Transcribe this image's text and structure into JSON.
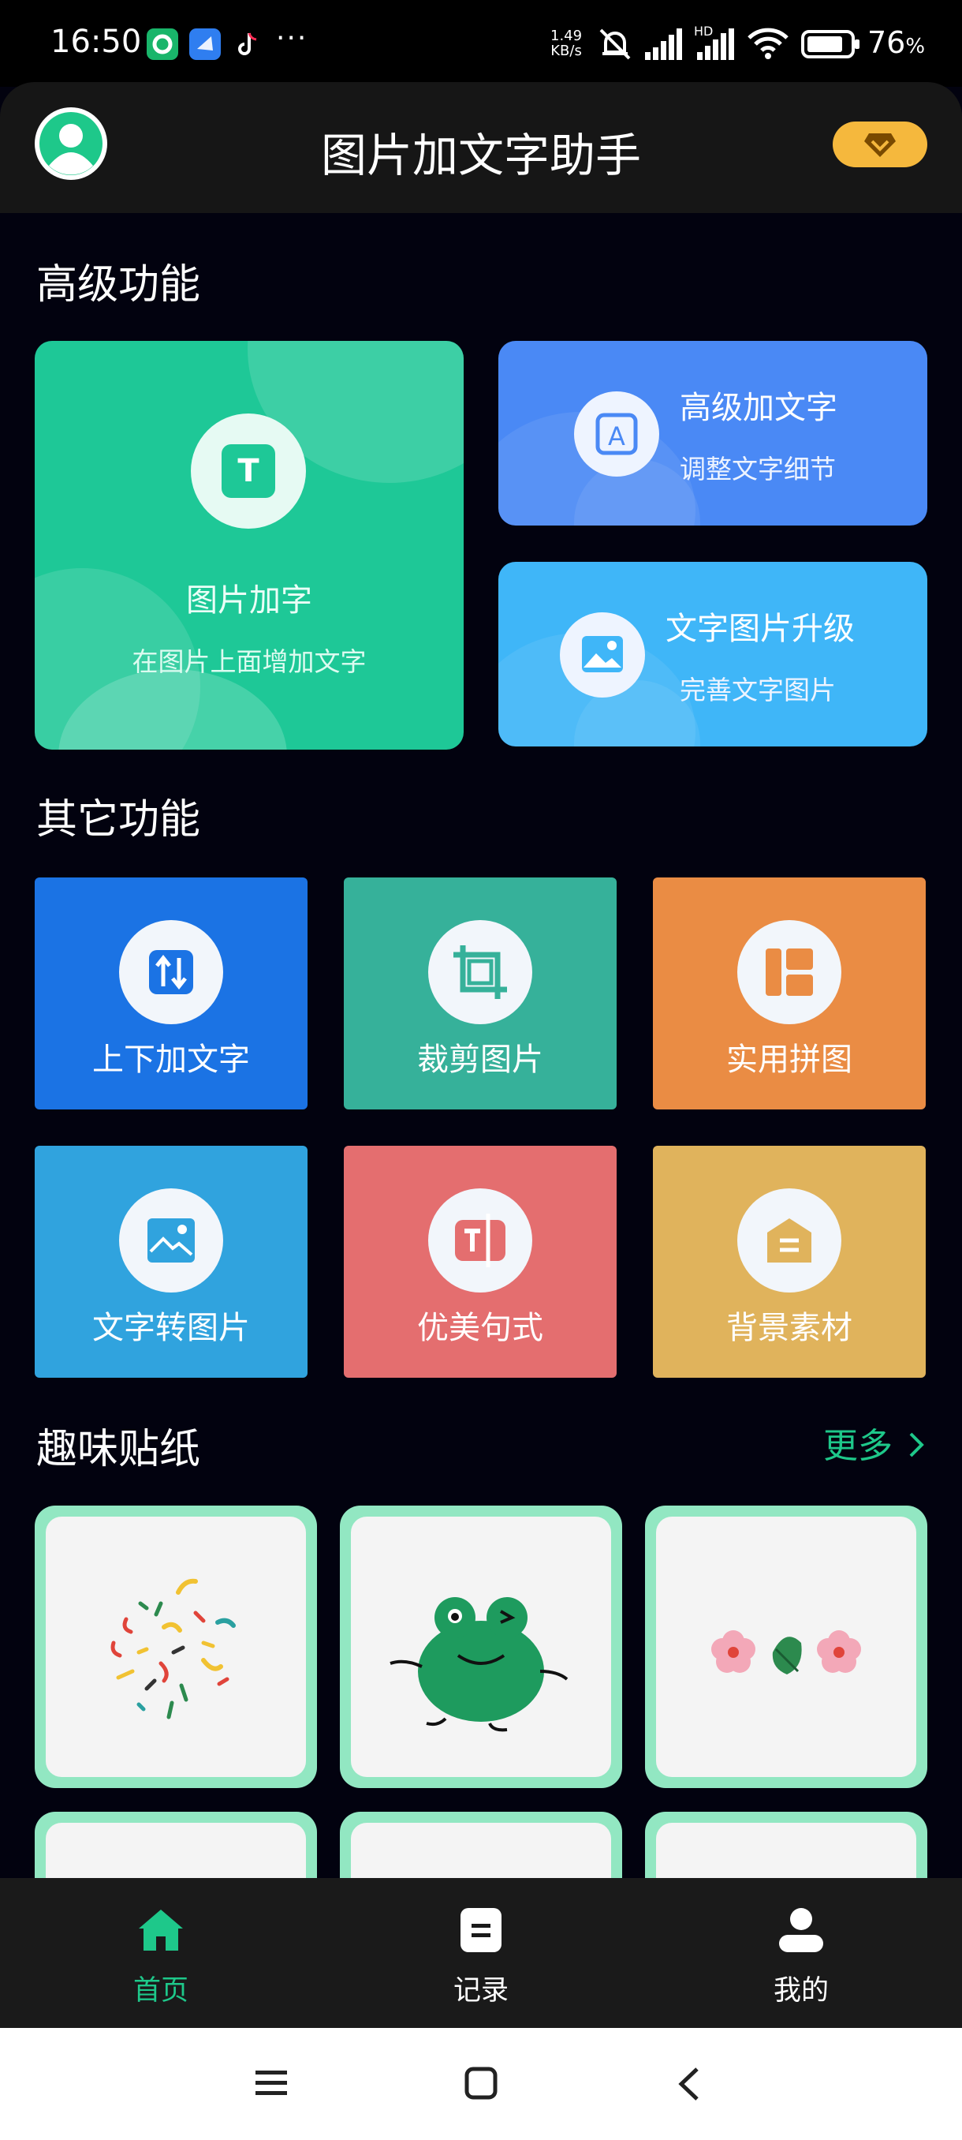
{
  "status_bar": {
    "time": "16:50",
    "more_indicator": "···",
    "net_speed_value": "1.49",
    "net_speed_unit": "KB/s",
    "signal_label": "HD",
    "battery_percent": "76",
    "battery_suffix": "%"
  },
  "header": {
    "title": "图片加文字助手",
    "avatar_icon": "user-avatar-icon",
    "vip_icon": "diamond-icon"
  },
  "advanced": {
    "section_title": "高级功能",
    "main_card": {
      "title": "图片加字",
      "subtitle": "在图片上面增加文字",
      "icon_letter": "T",
      "color": "#1ec897"
    },
    "card_1": {
      "title": "高级加文字",
      "subtitle": "调整文字细节",
      "icon_letter": "A",
      "color": "#4a89f5"
    },
    "card_2": {
      "title": "文字图片升级",
      "subtitle": "完善文字图片",
      "icon": "image-icon",
      "color": "#3fb6f8"
    }
  },
  "other": {
    "section_title": "其它功能",
    "tiles": [
      {
        "label": "上下加文字",
        "color": "#1b73e4",
        "icon": "swap-vertical-icon"
      },
      {
        "label": "裁剪图片",
        "color": "#36b19a",
        "icon": "crop-icon"
      },
      {
        "label": "实用拼图",
        "color": "#ea8c44",
        "icon": "collage-icon"
      },
      {
        "label": "文字转图片",
        "color": "#30a3de",
        "icon": "picture-icon"
      },
      {
        "label": "优美句式",
        "color": "#e46e6f",
        "icon": "text-box-icon"
      },
      {
        "label": "背景素材",
        "color": "#e0b35c",
        "icon": "material-icon"
      }
    ]
  },
  "stickers": {
    "section_title": "趣味贴纸",
    "more_label": "更多",
    "more_icon": "chevron-right-icon",
    "items": [
      "confetti-sticker",
      "frog-sticker",
      "flower-leaf-sticker",
      "sticker-4",
      "sticker-5",
      "sticker-6"
    ]
  },
  "bottom_nav": {
    "items": [
      {
        "label": "首页",
        "icon": "home-icon",
        "active": true
      },
      {
        "label": "记录",
        "icon": "record-icon",
        "active": false
      },
      {
        "label": "我的",
        "icon": "profile-icon",
        "active": false
      }
    ],
    "active_color": "#1ec88a"
  }
}
